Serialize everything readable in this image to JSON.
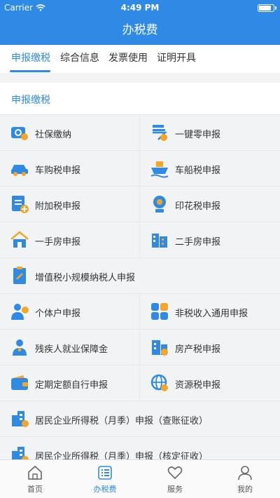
{
  "status": {
    "carrier": "Carrier",
    "time": "4:49 PM",
    "battery_level": 0.92
  },
  "nav": {
    "title": "办税费"
  },
  "tabs": [
    {
      "label": "申报缴税",
      "active": true
    },
    {
      "label": "综合信息",
      "active": false
    },
    {
      "label": "发票使用",
      "active": false
    },
    {
      "label": "证明开具",
      "active": false
    }
  ],
  "section": {
    "title": "申报缴税"
  },
  "items": [
    {
      "label": "社保缴纳",
      "icon": "social-insurance-icon"
    },
    {
      "label": "一键零申报",
      "icon": "zero-declaration-icon"
    },
    {
      "label": "车购税申报",
      "icon": "car-purchase-icon"
    },
    {
      "label": "车船税申报",
      "icon": "vessel-icon"
    },
    {
      "label": "附加税申报",
      "icon": "surcharge-icon"
    },
    {
      "label": "印花税申报",
      "icon": "stamp-icon"
    },
    {
      "label": "一手房申报",
      "icon": "new-house-icon"
    },
    {
      "label": "二手房申报",
      "icon": "second-house-icon"
    },
    {
      "label": "增值税小规模纳税人申报",
      "icon": "vat-icon"
    },
    {
      "label": "个体户申报",
      "icon": "individual-business-icon"
    },
    {
      "label": "非税收入通用申报",
      "icon": "non-tax-income-icon"
    },
    {
      "label": "残疾人就业保障金",
      "icon": "disability-employment-icon"
    },
    {
      "label": "房产税申报",
      "icon": "property-tax-icon"
    },
    {
      "label": "定期定额自行申报",
      "icon": "wallet-icon"
    },
    {
      "label": "资源税申报",
      "icon": "globe-icon"
    },
    {
      "label": "居民企业所得税（月季）申报（查账征收）",
      "icon": "enterprise-building-icon"
    },
    {
      "label": "居民企业所得税（月季）申报（核定征收）",
      "icon": "enterprise-building-icon"
    }
  ],
  "tabbar": [
    {
      "label": "首页",
      "icon": "home-icon",
      "active": false
    },
    {
      "label": "办税费",
      "icon": "list-icon",
      "active": true
    },
    {
      "label": "服务",
      "icon": "heart-icon",
      "active": false
    },
    {
      "label": "我的",
      "icon": "user-icon",
      "active": false
    }
  ],
  "colors": {
    "primary": "#2f8ae6",
    "accent_orange": "#f5a623",
    "background": "#f2f3f5"
  }
}
